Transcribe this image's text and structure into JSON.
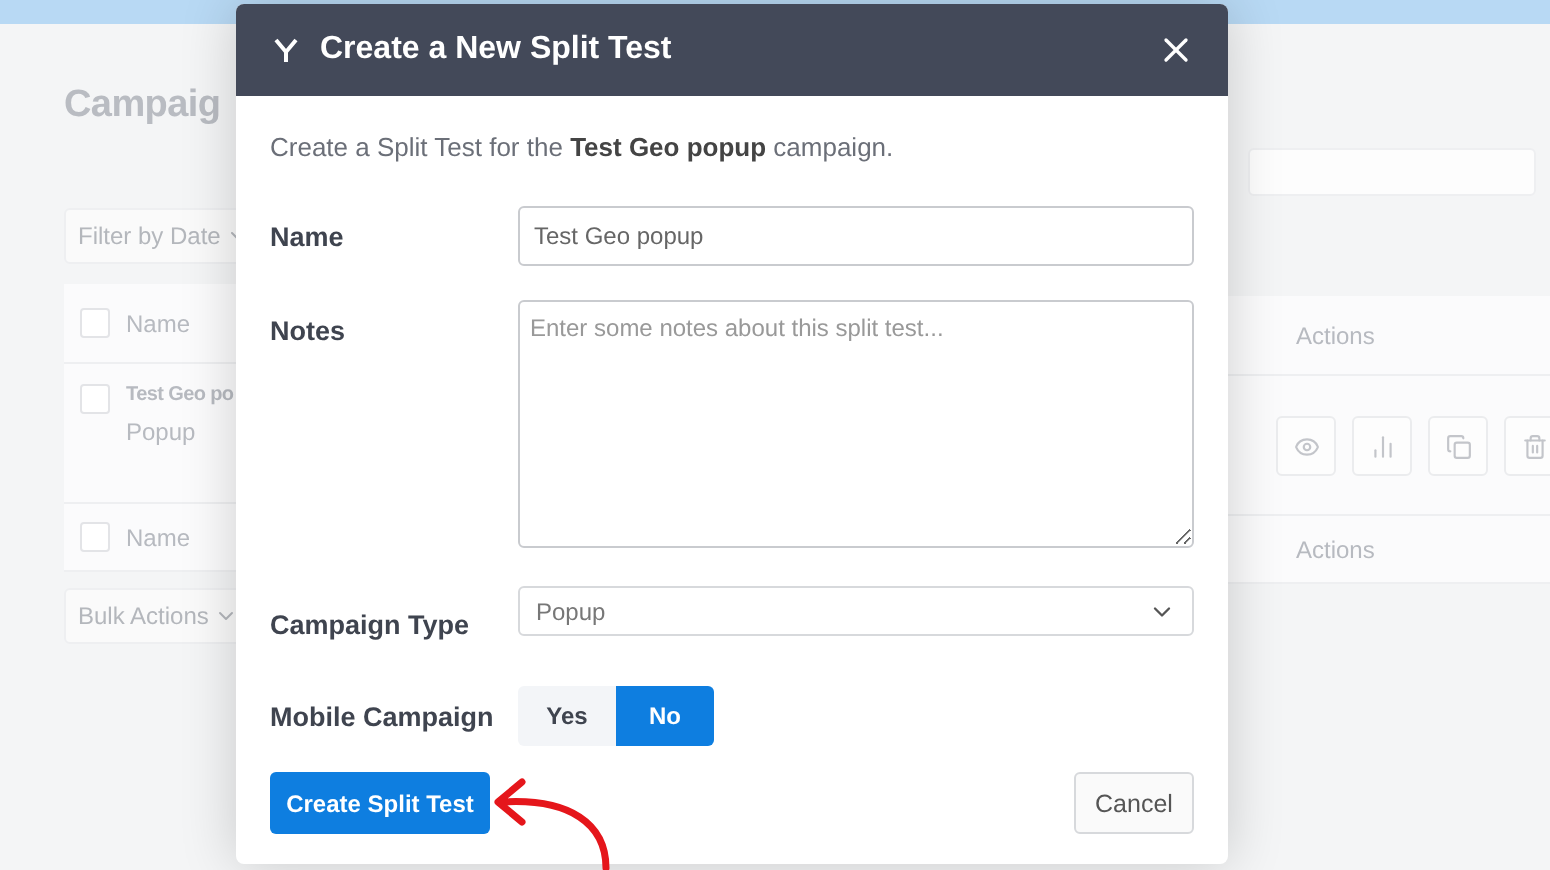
{
  "page": {
    "title": "Campaig",
    "filter": "Filter by Date",
    "table": {
      "header": {
        "name": "Name",
        "actions": "Actions",
        "checked": false
      },
      "rows": [
        {
          "name": "Test Geo po",
          "type": "Popup",
          "checked": false
        }
      ],
      "footer": {
        "name": "Name",
        "actions": "Actions",
        "checked": false
      }
    },
    "bulk_actions": "Bulk Actions"
  },
  "modal": {
    "title": "Create a New Split Test",
    "intro": "Create a Split Test for the **Test Geo popup** campaign.",
    "fields": [
      {
        "kind": "text",
        "label": "Name",
        "value": "Test Geo popup"
      },
      {
        "kind": "textarea",
        "label": "Notes",
        "placeholder": "Enter some notes about this split test..."
      },
      {
        "kind": "select",
        "label": "Campaign Type",
        "value": "Popup"
      },
      {
        "kind": "toggle",
        "label": "Mobile Campaign",
        "options": [
          {
            "label": "Yes",
            "selected": false
          },
          {
            "label": "No",
            "selected": true
          }
        ]
      }
    ],
    "buttons": {
      "primary": "Create Split Test",
      "secondary": "Cancel"
    }
  }
}
